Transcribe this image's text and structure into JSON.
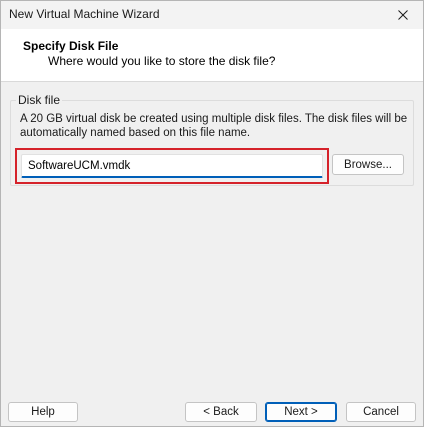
{
  "window": {
    "title": "New Virtual Machine Wizard",
    "close_icon": "close-icon"
  },
  "header": {
    "title": "Specify Disk File",
    "subtitle": "Where would you like to store the disk file?"
  },
  "disk_file": {
    "group_label": "Disk file",
    "description": "A 20 GB virtual disk be created using multiple disk files. The disk files will be automatically named based on this file name.",
    "file_name": "SoftwareUCM.vmdk",
    "browse_label": "Browse..."
  },
  "footer": {
    "help_label": "Help",
    "back_label": "< Back",
    "next_label": "Next >",
    "cancel_label": "Cancel"
  },
  "colors": {
    "highlight_border": "#d5222a",
    "focus_accent": "#005fb8"
  }
}
